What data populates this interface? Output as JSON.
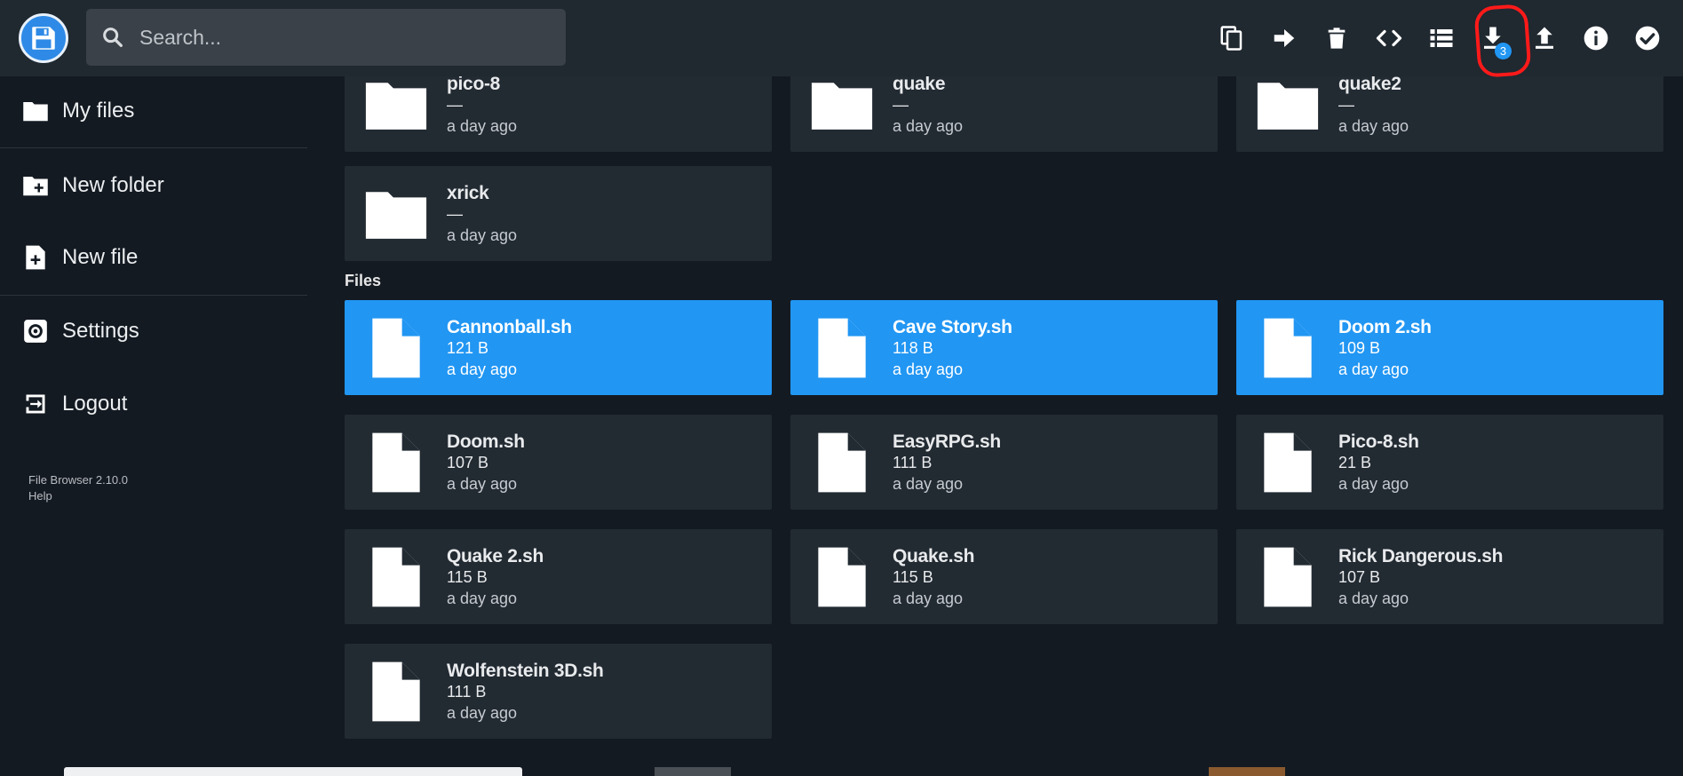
{
  "search": {
    "placeholder": "Search..."
  },
  "toolbar": {
    "actions": [
      {
        "icon": "copy-icon"
      },
      {
        "icon": "move-icon"
      },
      {
        "icon": "delete-icon"
      },
      {
        "icon": "code-icon"
      },
      {
        "icon": "list-view-icon"
      },
      {
        "icon": "download-icon",
        "badge": "3"
      },
      {
        "icon": "upload-icon"
      },
      {
        "icon": "info-icon"
      },
      {
        "icon": "check-icon"
      }
    ]
  },
  "sidebar": {
    "items": [
      {
        "label": "My files",
        "icon": "folder-icon"
      },
      {
        "label": "New folder",
        "icon": "new-folder-icon"
      },
      {
        "label": "New file",
        "icon": "new-file-icon"
      },
      {
        "label": "Settings",
        "icon": "settings-icon"
      },
      {
        "label": "Logout",
        "icon": "logout-icon"
      }
    ],
    "version": "File Browser 2.10.0",
    "help": "Help"
  },
  "folders": [
    {
      "name": "pico-8",
      "size": "—",
      "modified": "a day ago"
    },
    {
      "name": "quake",
      "size": "—",
      "modified": "a day ago"
    },
    {
      "name": "quake2",
      "size": "—",
      "modified": "a day ago"
    },
    {
      "name": "xrick",
      "size": "—",
      "modified": "a day ago"
    }
  ],
  "files_label": "Files",
  "files": [
    {
      "name": "Cannonball.sh",
      "size": "121 B",
      "modified": "a day ago",
      "selected": true
    },
    {
      "name": "Cave Story.sh",
      "size": "118 B",
      "modified": "a day ago",
      "selected": true
    },
    {
      "name": "Doom 2.sh",
      "size": "109 B",
      "modified": "a day ago",
      "selected": true
    },
    {
      "name": "Doom.sh",
      "size": "107 B",
      "modified": "a day ago",
      "selected": false
    },
    {
      "name": "EasyRPG.sh",
      "size": "111 B",
      "modified": "a day ago",
      "selected": false
    },
    {
      "name": "Pico-8.sh",
      "size": "21 B",
      "modified": "a day ago",
      "selected": false
    },
    {
      "name": "Quake 2.sh",
      "size": "115 B",
      "modified": "a day ago",
      "selected": false
    },
    {
      "name": "Quake.sh",
      "size": "115 B",
      "modified": "a day ago",
      "selected": false
    },
    {
      "name": "Rick Dangerous.sh",
      "size": "107 B",
      "modified": "a day ago",
      "selected": false
    },
    {
      "name": "Wolfenstein 3D.sh",
      "size": "111 B",
      "modified": "a day ago",
      "selected": false
    }
  ],
  "colors": {
    "accent": "#2196f3",
    "background": "#141a22",
    "card": "#222a32",
    "header": "#202830",
    "annotation": "#ff1a1a"
  }
}
